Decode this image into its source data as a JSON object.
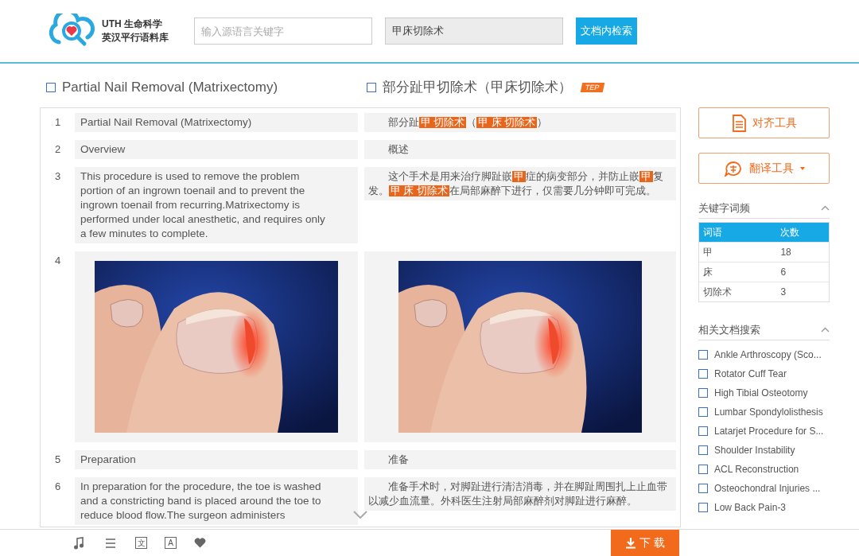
{
  "header": {
    "logo_line1": "UTH 生命科学",
    "logo_line2": "英汉平行语料库",
    "source_search": {
      "placeholder": "输入源语言关键字"
    },
    "target_search": {
      "value": "甲床切除术"
    },
    "search_button": "文档内检索"
  },
  "document": {
    "title_en": "Partial Nail Removal (Matrixectomy)",
    "title_zh": "部分趾甲切除术（甲床切除术）",
    "badge": "TEP"
  },
  "rows": [
    {
      "number": "1",
      "kind": "text",
      "en": "Partial Nail Removal (Matrixectomy)",
      "zh": [
        {
          "text": "部分趾",
          "highlight": false
        },
        {
          "text": "甲 切除术",
          "highlight": true
        },
        {
          "text": "（",
          "highlight": false
        },
        {
          "text": "甲 床 切除术",
          "highlight": true
        },
        {
          "text": "）",
          "highlight": false
        }
      ]
    },
    {
      "number": "2",
      "kind": "text",
      "en": "Overview",
      "zh": [
        {
          "text": "概述",
          "highlight": false
        }
      ]
    },
    {
      "number": "3",
      "kind": "text",
      "en": "This procedure is used to remove the problem portion of an ingrown toenail and to prevent the ingrown toenail from recurring.Matrixectomy is performed under local anesthetic, and requires only a few minutes to complete.",
      "zh": [
        {
          "text": "这个手术是用来治疗脚趾嵌",
          "highlight": false
        },
        {
          "text": "甲",
          "highlight": true
        },
        {
          "text": "症的病变部分，并防止嵌",
          "highlight": false
        },
        {
          "text": "甲",
          "highlight": true
        },
        {
          "text": "复发。",
          "highlight": false
        },
        {
          "text": "甲 床 切除术",
          "highlight": true
        },
        {
          "text": "在局部麻醉下进行，仅需要几分钟即可完成。",
          "highlight": false
        }
      ]
    },
    {
      "number": "4",
      "kind": "picture"
    },
    {
      "number": "5",
      "kind": "text",
      "en": "Preparation",
      "zh": [
        {
          "text": "准备",
          "highlight": false
        }
      ]
    },
    {
      "number": "6",
      "kind": "text",
      "en": "In preparation for the procedure, the toe is washed and a constricting band is placed around the toe to reduce blood flow.The surgeon administers",
      "zh": [
        {
          "text": "准备手术时，对脚趾进行清洁消毒，并在脚趾周围扎上止血带以减少血流量。外科医生注射局部麻醉剂对脚趾进行麻醉。",
          "highlight": false
        }
      ]
    }
  ],
  "tools": [
    {
      "label": "对齐工具",
      "kind": "document",
      "dropdown": false
    },
    {
      "label": "翻译工具",
      "kind": "translate",
      "dropdown": true
    }
  ],
  "keyword_panel": {
    "title": "关键字词频",
    "expanded": true,
    "columns": [
      "词语",
      "次数"
    ],
    "rows": [
      [
        "甲",
        "18"
      ],
      [
        "床",
        "6"
      ],
      [
        "切除术",
        "3"
      ]
    ]
  },
  "related_panel": {
    "title": "相关文档搜索",
    "expanded": true,
    "items": [
      "Ankle Arthroscopy (Sco...",
      "Rotator Cuff Tear",
      "High Tibial Osteotomy",
      "Lumbar Spondylolisthesis",
      "Latarjet Procedure for S...",
      "Shoulder Instability",
      "ACL Reconstruction",
      "Osteochondral Injuries ...",
      "Low Back Pain-3"
    ]
  },
  "bottom_bar": {
    "glyph_buttons": [
      "文",
      "A"
    ],
    "download_button": "下 载"
  }
}
